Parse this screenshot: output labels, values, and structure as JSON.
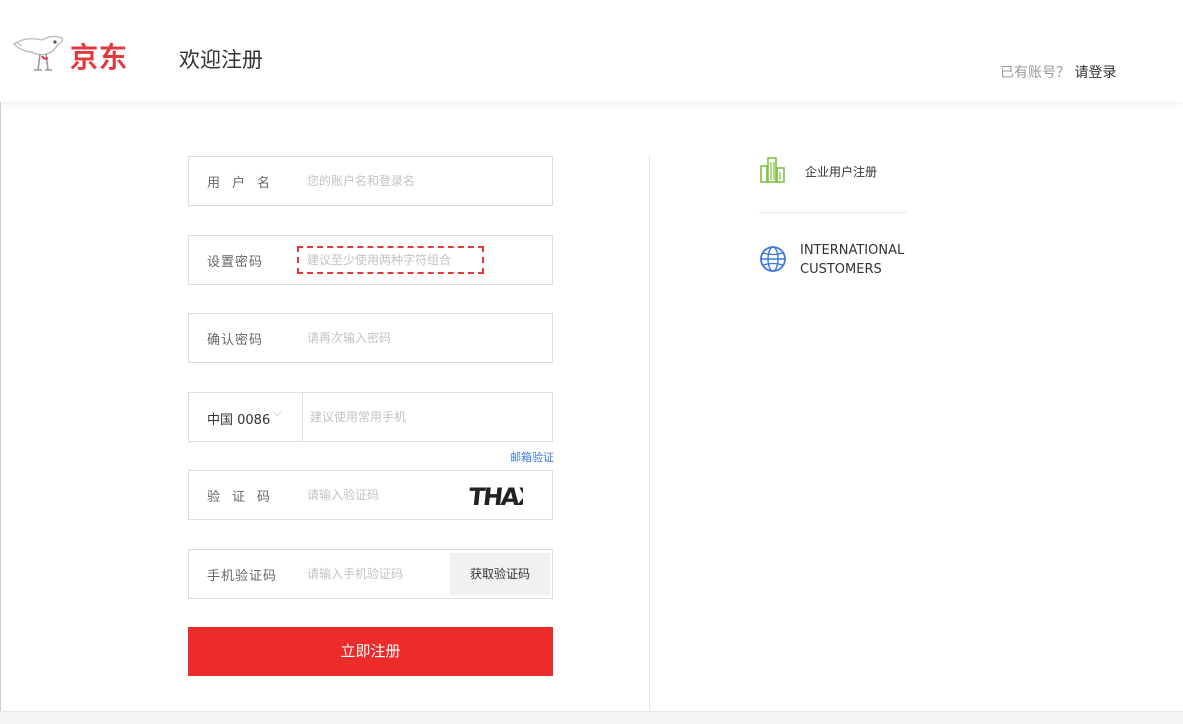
{
  "header": {
    "logo_text": "京东",
    "welcome": "欢迎注册",
    "login_prompt": "已有账号？",
    "login_link": "请登录"
  },
  "form": {
    "username": {
      "label": "用户名",
      "placeholder": "您的账户名和登录名"
    },
    "password": {
      "label": "设置密码",
      "placeholder": "建议至少使用两种字符组合"
    },
    "confirm": {
      "label": "确认密码",
      "placeholder": "请再次输入密码"
    },
    "phone": {
      "country": "中国 0086",
      "placeholder": "建议使用常用手机"
    },
    "email_verify": "邮箱验证",
    "captcha": {
      "label": "验证码",
      "placeholder": "请输入验证码",
      "image_text": "THAX"
    },
    "sms": {
      "label": "手机验证码",
      "placeholder": "请输入手机验证码",
      "button": "获取验证码"
    },
    "submit": "立即注册"
  },
  "side": {
    "enterprise": "企业用户注册",
    "international_line1": "INTERNATIONAL",
    "international_line2": "CUSTOMERS"
  },
  "colors": {
    "brand_red": "#e4393c",
    "button_red": "#ec2b2b",
    "enterprise_green": "#7dc242",
    "globe_blue": "#3b76e0"
  },
  "icons": [
    "jd-dog-logo-icon",
    "chevron-down-icon",
    "building-icon",
    "globe-icon"
  ]
}
